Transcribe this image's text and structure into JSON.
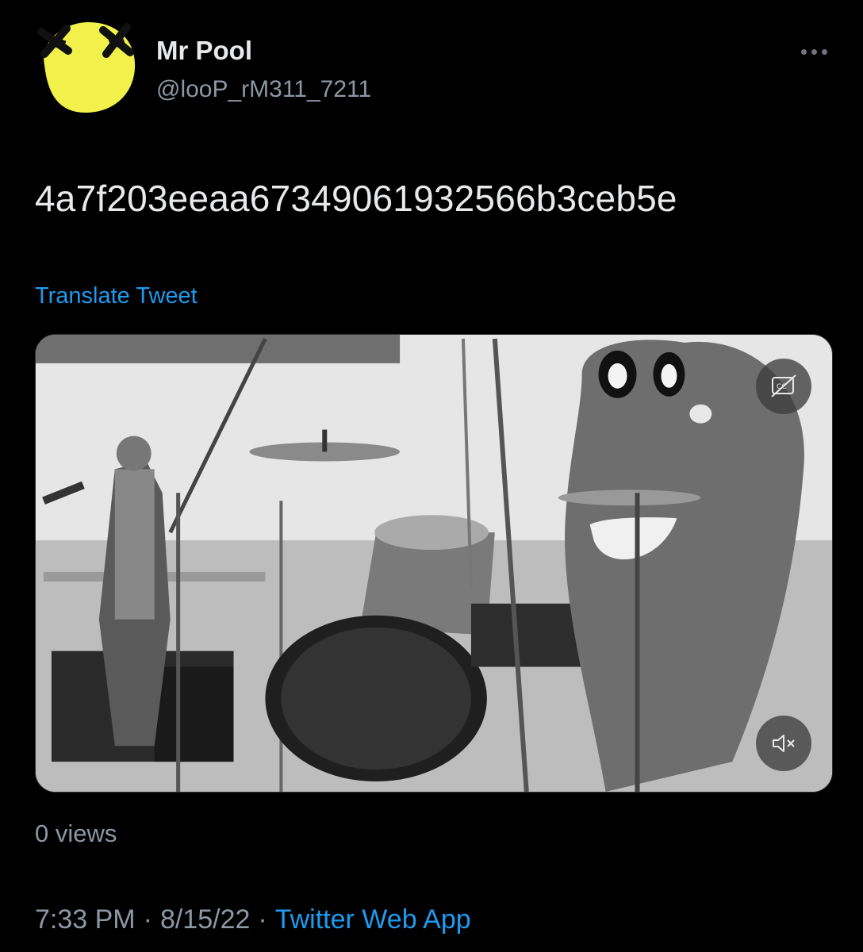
{
  "author": {
    "display_name": "Mr Pool",
    "handle": "@looP_rM311_7211",
    "avatar_icon": "yellow-smiley-x-eyes-icon",
    "avatar_color": "#f2f04a"
  },
  "more_icon": "more-horizontal-icon",
  "tweet": {
    "text": "4a7f203eeaa67349061932566b3ceb5e",
    "translate_label": "Translate Tweet"
  },
  "media": {
    "type": "video",
    "cc_icon": "closed-captions-off-icon",
    "mute_icon": "volume-muted-icon"
  },
  "stats": {
    "views": "0 views"
  },
  "meta": {
    "time": "7:33 PM",
    "date": "8/15/22",
    "separator": "·",
    "source": "Twitter Web App"
  },
  "colors": {
    "background": "#000000",
    "link": "#1d9bf0",
    "secondary_text": "#8b98a5",
    "primary_text": "#e7e9ea"
  }
}
